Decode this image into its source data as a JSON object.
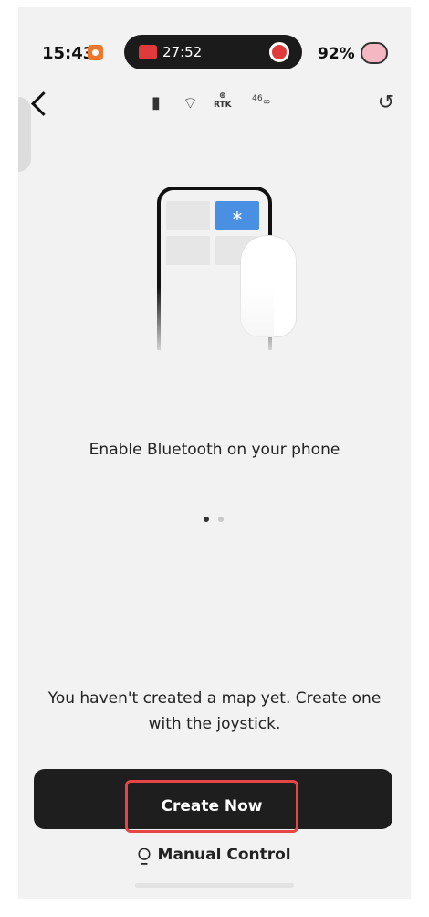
{
  "status_bar": {
    "time": "15:43",
    "record_time": "27:52",
    "battery": "92%"
  },
  "toolbar": {
    "back_icon": "chevron-left-icon",
    "icons": [
      "battery-icon",
      "wifi-icon",
      "rtk-icon",
      "cellular-link-icon"
    ],
    "rtk_label": "RTK",
    "cell_label": "46",
    "refresh_icon": "refresh-icon"
  },
  "illustration": {
    "bluetooth_symbol": "∗"
  },
  "main": {
    "message": "Enable Bluetooth on your phone",
    "pager": {
      "count": 2,
      "active": 0
    },
    "empty_map_text": "You haven't created a map yet. Create one with the joystick."
  },
  "actions": {
    "create_label": "Create Now",
    "manual_label": "Manual Control",
    "manual_icon": "gamepad-icon"
  },
  "colors": {
    "accent_blue": "#4a90e2",
    "highlight_red": "#e64545",
    "button_dark": "#1e1e1e",
    "recording_red": "#e03a3a"
  }
}
